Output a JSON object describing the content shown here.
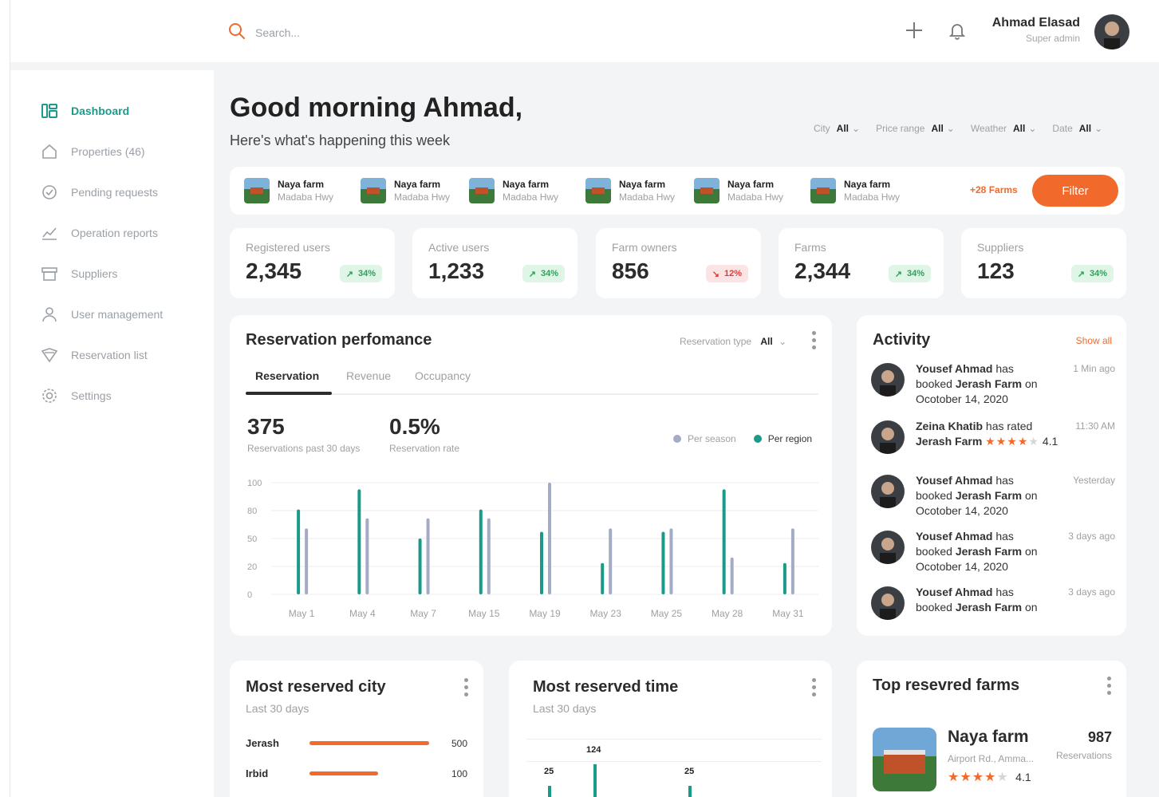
{
  "header": {
    "search_placeholder": "Search...",
    "user_name": "Ahmad Elasad",
    "user_role": "Super admin"
  },
  "sidebar": {
    "items": [
      {
        "label": "Dashboard",
        "icon": "dashboard-icon",
        "active": true
      },
      {
        "label": "Properties (46)",
        "icon": "home-icon"
      },
      {
        "label": "Pending requests",
        "icon": "check-circle-icon"
      },
      {
        "label": "Operation reports",
        "icon": "chart-icon"
      },
      {
        "label": "Suppliers",
        "icon": "archive-icon"
      },
      {
        "label": "User management",
        "icon": "user-icon"
      },
      {
        "label": "Reservation list",
        "icon": "tag-icon"
      },
      {
        "label": "Settings",
        "icon": "gear-icon"
      }
    ]
  },
  "greeting": {
    "title": "Good morning Ahmad,",
    "subtitle": "Here's what's happening this week"
  },
  "filters": [
    {
      "label": "City",
      "value": "All"
    },
    {
      "label": "Price range",
      "value": "All"
    },
    {
      "label": "Weather",
      "value": "All"
    },
    {
      "label": "Date",
      "value": "All"
    }
  ],
  "farms": [
    {
      "name": "Naya farm",
      "location": "Madaba Hwy"
    },
    {
      "name": "Naya farm",
      "location": "Madaba Hwy"
    },
    {
      "name": "Naya farm",
      "location": "Madaba Hwy"
    },
    {
      "name": "Naya farm",
      "location": "Madaba Hwy"
    },
    {
      "name": "Naya farm",
      "location": "Madaba Hwy"
    },
    {
      "name": "Naya farm",
      "location": "Madaba Hwy"
    }
  ],
  "more_farms": "+28 Farms",
  "filter_button": "Filter",
  "stats": [
    {
      "label": "Registered users",
      "value": "2,345",
      "change": "34%",
      "direction": "up"
    },
    {
      "label": "Active users",
      "value": "1,233",
      "change": "34%",
      "direction": "up"
    },
    {
      "label": "Farm owners",
      "value": "856",
      "change": "12%",
      "direction": "down"
    },
    {
      "label": "Farms",
      "value": "2,344",
      "change": "34%",
      "direction": "up"
    },
    {
      "label": "Suppliers",
      "value": "123",
      "change": "34%",
      "direction": "up"
    }
  ],
  "reservation": {
    "title": "Reservation perfomance",
    "type_label": "Reservation type",
    "type_value": "All",
    "tabs": [
      "Reservation",
      "Revenue",
      "Occupancy"
    ],
    "kpi1_value": "375",
    "kpi1_caption": "Reservations past 30 days",
    "kpi2_value": "0.5%",
    "kpi2_caption": "Reservation rate",
    "legend": [
      "Per season",
      "Per region"
    ]
  },
  "chart_data": {
    "type": "bar",
    "categories": [
      "May 1",
      "May 4",
      "May 7",
      "May 15",
      "May 19",
      "May 23",
      "May 25",
      "May 28",
      "May 31"
    ],
    "y_ticks": [
      "100",
      "80",
      "50",
      "20",
      "0"
    ],
    "series": [
      {
        "name": "Per region",
        "values": [
          76,
          94,
          50,
          76,
          56,
          28,
          56,
          94,
          28
        ]
      },
      {
        "name": "Per season",
        "values": [
          59,
          68,
          68,
          68,
          100,
          59,
          59,
          33,
          59
        ]
      }
    ],
    "colors": {
      "Per region": "#1b9a8a",
      "Per season": "#a4abc4"
    },
    "grid": true
  },
  "activity": {
    "title": "Activity",
    "show_all": "Show all",
    "items": [
      {
        "line1_name": "Yousef Ahmad",
        "line1_rest": " has",
        "line2_pre": "booked ",
        "line2_bold": "Jerash Farm",
        "line2_post": " on",
        "line3": "Ocotober 14, 2020",
        "time": "1 Min ago"
      },
      {
        "line1_name": "Zeina Khatib",
        "line1_rest": " has rated",
        "line2_bold": "Jerash Farm",
        "rating": "4.1",
        "time": "11:30 AM"
      },
      {
        "line1_name": "Yousef Ahmad",
        "line1_rest": " has",
        "line2_pre": "booked ",
        "line2_bold": "Jerash Farm",
        "line2_post": " on",
        "line3": "Ocotober 14, 2020",
        "time": "Yesterday"
      },
      {
        "line1_name": "Yousef Ahmad",
        "line1_rest": " has",
        "line2_pre": "booked ",
        "line2_bold": "Jerash Farm",
        "line2_post": " on",
        "line3": "Ocotober 14, 2020",
        "time": "3 days ago"
      },
      {
        "line1_name": "Yousef Ahmad",
        "line1_rest": " has",
        "line2_pre": "booked ",
        "line2_bold": "Jerash Farm",
        "line2_post": " on",
        "time": "3 days ago"
      }
    ]
  },
  "city": {
    "title": "Most reserved city",
    "subtitle": "Last 30 days",
    "rows": [
      {
        "name": "Jerash",
        "value": "500",
        "share": 1.0
      },
      {
        "name": "Irbid",
        "value": "100",
        "share": 0.57
      }
    ]
  },
  "time": {
    "title": "Most reserved time",
    "subtitle": "Last 30 days",
    "labels": [
      "25",
      "124",
      "25"
    ]
  },
  "top_farms": {
    "title": "Top resevred farms",
    "farm_name": "Naya farm",
    "farm_location": "Airport Rd., Amma...",
    "rating": "4.1",
    "count": "987",
    "count_label": "Reservations"
  }
}
